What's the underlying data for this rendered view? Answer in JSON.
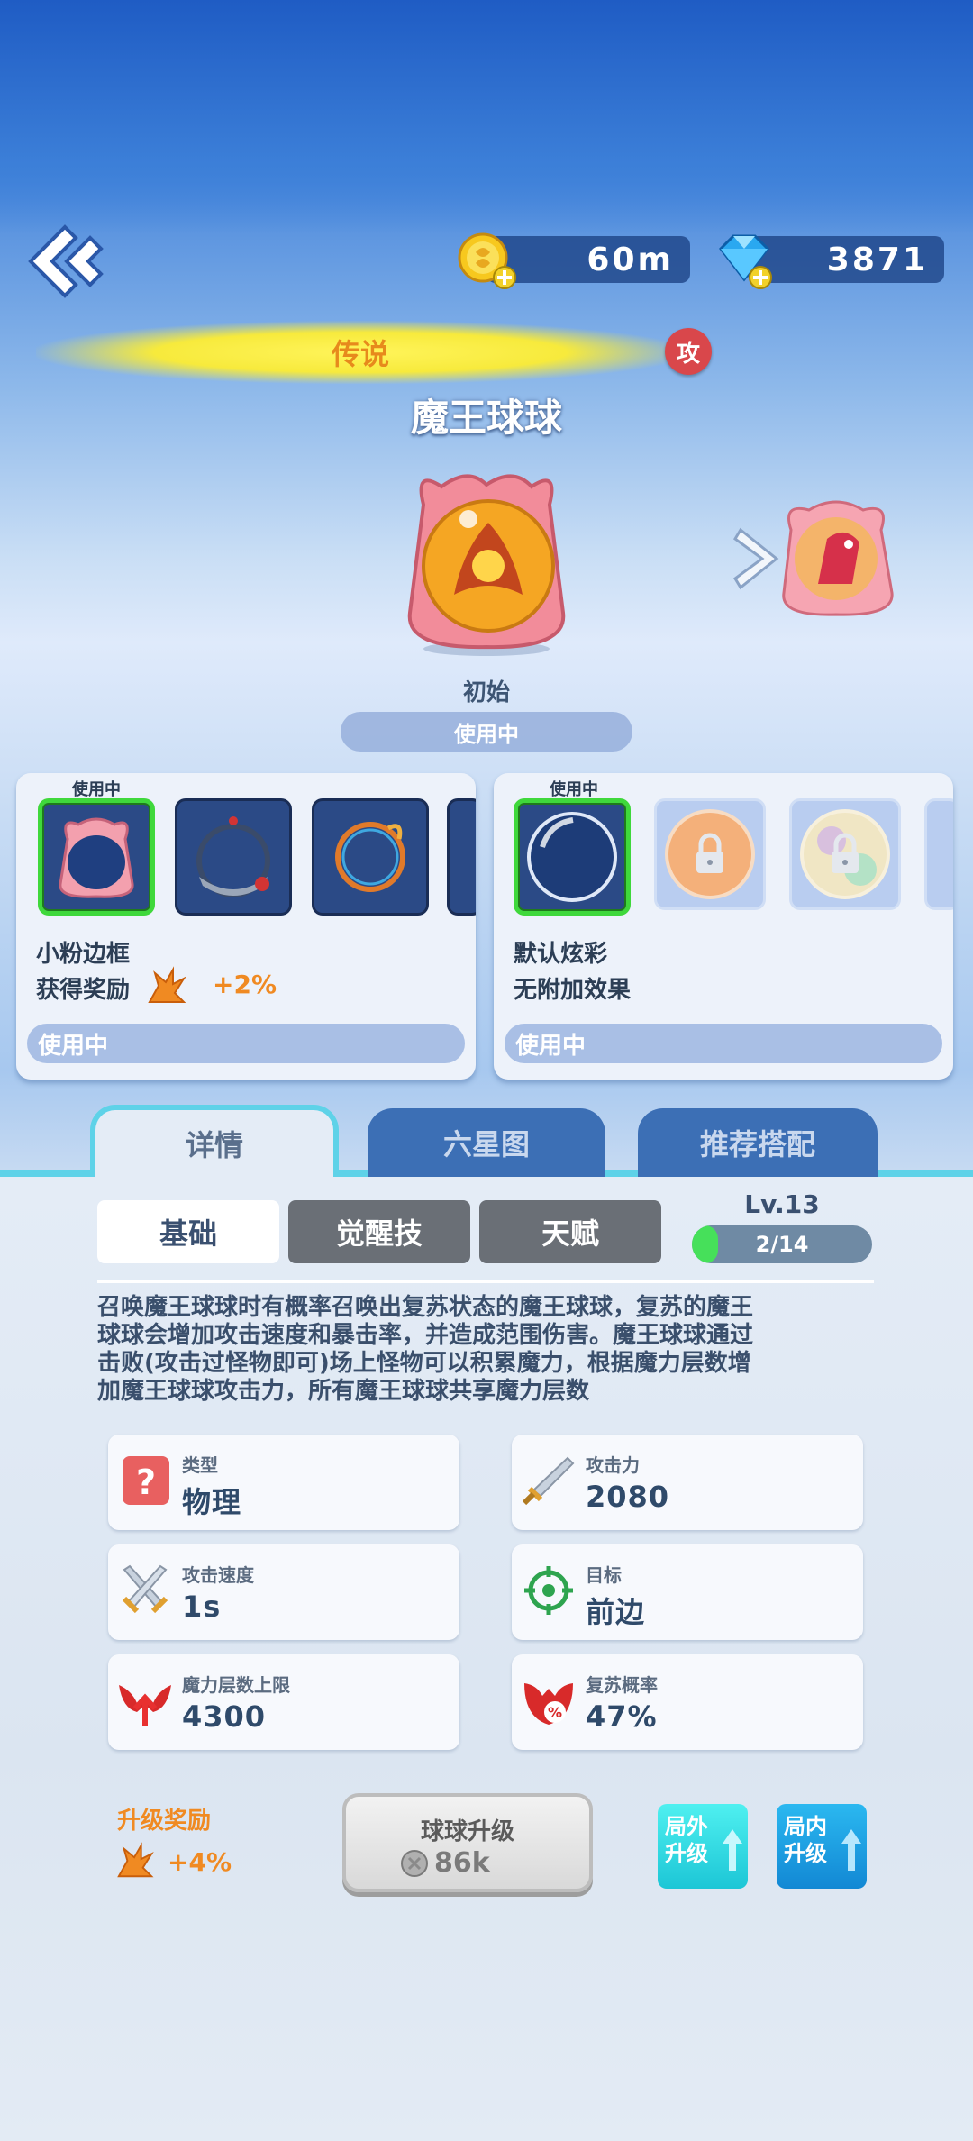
{
  "header": {
    "coins": "60m",
    "gems": "3871"
  },
  "ball": {
    "rarity": "传说",
    "type_badge": "攻",
    "name": "魔王球球",
    "skin_state": "初始",
    "status": "使用中"
  },
  "frame_panel": {
    "inuse_tag": "使用中",
    "selected_name": "小粉边框",
    "bonus_label": "获得奖励",
    "bonus_value": "+2%",
    "status_bar": "使用中"
  },
  "effect_panel": {
    "inuse_tag": "使用中",
    "selected_name": "默认炫彩",
    "desc": "无附加效果",
    "status_bar": "使用中"
  },
  "tabs": [
    "详情",
    "六星图",
    "推荐搭配"
  ],
  "subtabs": [
    "基础",
    "觉醒技",
    "天赋"
  ],
  "level": {
    "label": "Lv.13",
    "progress_text": "2/14",
    "progress": 0.1428
  },
  "description": "召唤魔王球球时有概率召唤出复苏状态的魔王球球，复苏的魔王球球会增加攻击速度和暴击率，并造成范围伤害。魔王球球通过击败(攻击过怪物即可)场上怪物可以积累魔力，根据魔力层数增加魔王球球攻击力，所有魔王球球共享魔力层数",
  "stats": [
    {
      "label": "类型",
      "value": "物理",
      "icon": "question-icon"
    },
    {
      "label": "攻击力",
      "value": "2080",
      "icon": "sword-icon"
    },
    {
      "label": "攻击速度",
      "value": "1s",
      "icon": "crossed-swords-icon"
    },
    {
      "label": "目标",
      "value": "前边",
      "icon": "target-icon"
    },
    {
      "label": "魔力层数上限",
      "value": "4300",
      "icon": "demon-wing-arrow-icon"
    },
    {
      "label": "复苏概率",
      "value": "47%",
      "icon": "demon-percent-icon"
    }
  ],
  "upgrade": {
    "reward_title": "升级奖励",
    "reward_value": "+4%",
    "button_title": "球球升级",
    "cost": "86k",
    "outside_btn": [
      "局外",
      "升级"
    ],
    "inside_btn": [
      "局内",
      "升级"
    ]
  },
  "colors": {
    "accent_cyan": "#5ed2e8",
    "selected_green": "#3fd83b",
    "reward_orange": "#f08a22"
  }
}
